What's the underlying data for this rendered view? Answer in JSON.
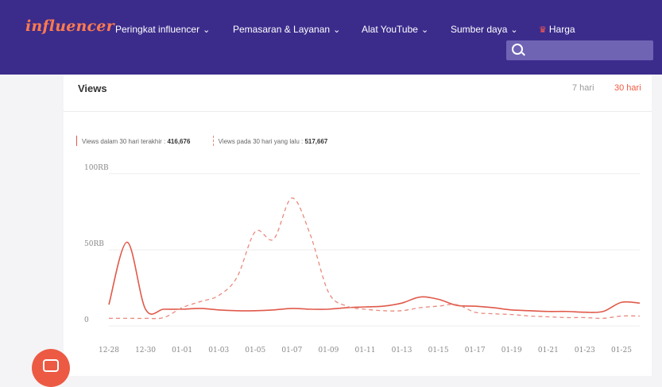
{
  "brand": {
    "logo_text": "influencer"
  },
  "nav": {
    "items": [
      {
        "label": "Peringkat influencer",
        "has_dropdown": true
      },
      {
        "label": "Pemasaran & Layanan",
        "has_dropdown": true
      },
      {
        "label": "Alat YouTube",
        "has_dropdown": true
      },
      {
        "label": "Sumber daya",
        "has_dropdown": true
      },
      {
        "label": "Harga",
        "has_dropdown": false
      }
    ],
    "search_placeholder": ""
  },
  "card": {
    "title": "Views",
    "periods": [
      {
        "label": "7 hari",
        "active": false
      },
      {
        "label": "30 hari",
        "active": true
      }
    ]
  },
  "legend": {
    "current_label": "Views dalam 30 hari terakhir :",
    "current_value": "416,676",
    "previous_label": "Views pada 30 hari yang lalu :",
    "previous_value": "517,667"
  },
  "chart_data": {
    "type": "line",
    "ytick_labels": [
      "0",
      "50RB",
      "100RB"
    ],
    "ytick_values": [
      0,
      50000,
      100000
    ],
    "ylim": [
      0,
      100000
    ],
    "x": [
      "12-28",
      "12-29",
      "12-30",
      "12-31",
      "01-01",
      "01-02",
      "01-03",
      "01-04",
      "01-05",
      "01-06",
      "01-07",
      "01-08",
      "01-09",
      "01-10",
      "01-11",
      "01-12",
      "01-13",
      "01-14",
      "01-15",
      "01-16",
      "01-17",
      "01-18",
      "01-19",
      "01-20",
      "01-21",
      "01-22",
      "01-23",
      "01-24",
      "01-25",
      "01-26"
    ],
    "xtick_labels": [
      "12-28",
      "12-30",
      "01-01",
      "01-03",
      "01-05",
      "01-07",
      "01-09",
      "01-11",
      "01-13",
      "01-15",
      "01-17",
      "01-19",
      "01-21",
      "01-23",
      "01-25"
    ],
    "series": [
      {
        "style": "solid",
        "color": "#e0594a",
        "values": [
          14000,
          55000,
          11000,
          11000,
          11000,
          11500,
          10500,
          10000,
          10000,
          10500,
          11500,
          11000,
          11000,
          12000,
          12500,
          13000,
          15000,
          19000,
          17500,
          13500,
          13000,
          12000,
          10500,
          10000,
          9500,
          9500,
          9000,
          9500,
          15500,
          15000
        ]
      },
      {
        "style": "dashed",
        "color": "#e88a7c",
        "values": [
          5000,
          5000,
          5000,
          5500,
          12000,
          16000,
          20000,
          32000,
          62000,
          57000,
          84000,
          60000,
          22000,
          13000,
          11000,
          10000,
          10000,
          12000,
          13000,
          14000,
          9000,
          8000,
          7500,
          6500,
          6000,
          5500,
          5500,
          5000,
          6500,
          6500
        ]
      }
    ],
    "grid": true
  },
  "chat": {
    "icon": "chat-icon"
  }
}
